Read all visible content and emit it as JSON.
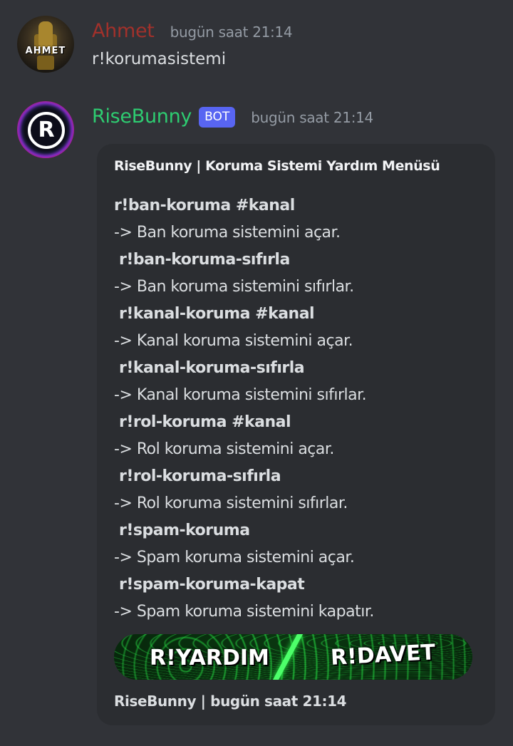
{
  "messages": [
    {
      "username": "Ahmet",
      "avatar_text": "AHMET",
      "timestamp": "bugün saat 21:14",
      "content": "r!korumasistemi"
    },
    {
      "username": "RiseBunny",
      "bot_tag": "BOT",
      "avatar_text": "R",
      "timestamp": "bugün saat 21:14",
      "embed": {
        "title": "RiseBunny | Koruma Sistemi Yardım Menüsü",
        "lines": [
          {
            "command": "r!ban-koruma #kanal",
            "description": "-> Ban koruma sistemini açar."
          },
          {
            "command": "r!ban-koruma-sıfırla",
            "description": "-> Ban koruma sistemini sıfırlar."
          },
          {
            "command": "r!kanal-koruma #kanal",
            "description": "-> Kanal koruma sistemini açar."
          },
          {
            "command": "r!kanal-koruma-sıfırla",
            "description": "-> Kanal koruma sistemini sıfırlar."
          },
          {
            "command": "r!rol-koruma #kanal",
            "description": "-> Rol koruma sistemini açar."
          },
          {
            "command": "r!rol-koruma-sıfırla",
            "description": "-> Rol koruma sistemini sıfırlar."
          },
          {
            "command": "r!spam-koruma",
            "description": "-> Spam koruma sistemini açar."
          },
          {
            "command": "r!spam-koruma-kapat",
            "description": "-> Spam koruma sistemini kapatır."
          }
        ],
        "banner": {
          "left_label": "R!YARDIM",
          "right_label": "R!DAVET"
        },
        "footer": "RiseBunny | bugün saat 21:14"
      }
    }
  ],
  "colors": {
    "background": "#313338",
    "embed_background": "#2b2d31",
    "ahmet_name": "#a1312b",
    "bot_name": "#2ecc71",
    "bot_tag": "#5865f2",
    "timestamp": "#949ba4",
    "text": "#dbdee1",
    "banner_green": "#21c23a"
  }
}
